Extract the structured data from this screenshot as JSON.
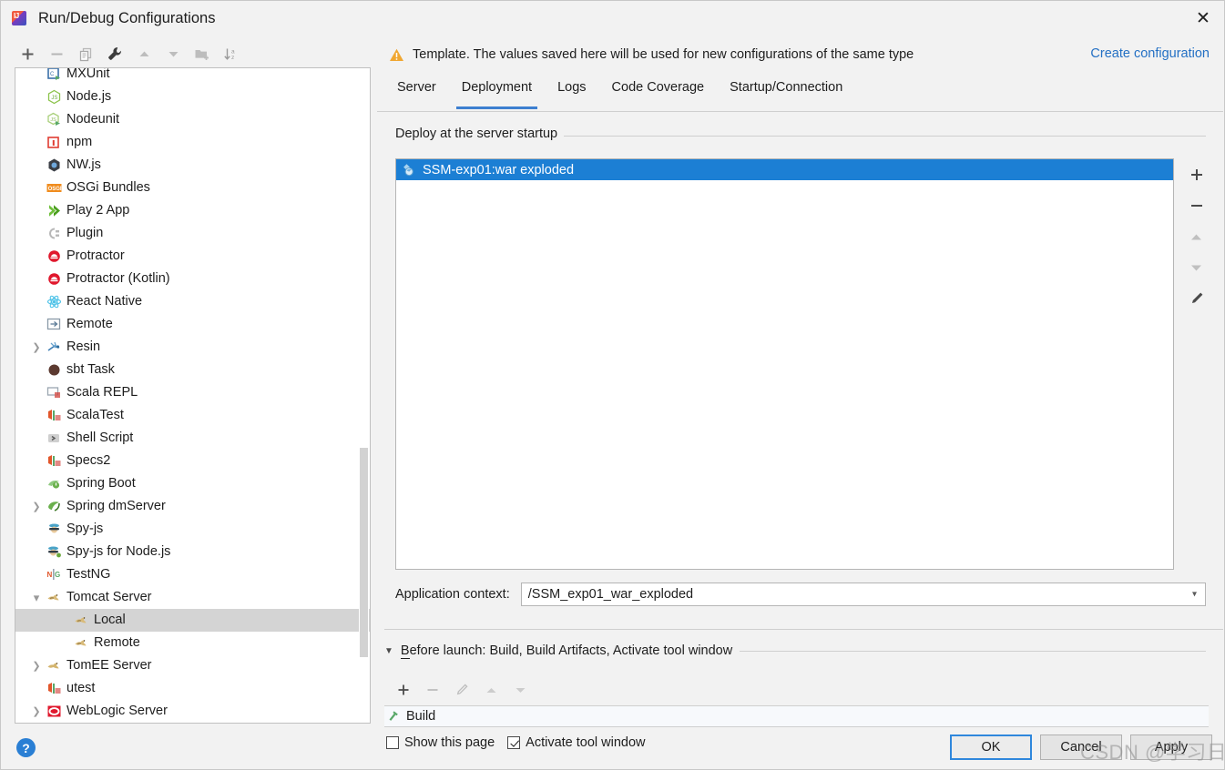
{
  "window": {
    "title": "Run/Debug Configurations",
    "app_icon": "intellij-idea-icon",
    "close_label": "✕"
  },
  "left_toolbar": {
    "buttons": [
      {
        "name": "add-configuration-button",
        "icon": "plus-icon",
        "label": "+"
      },
      {
        "name": "remove-configuration-button",
        "icon": "minus-icon",
        "label": "−"
      },
      {
        "name": "copy-configuration-button",
        "icon": "copy-icon",
        "label": "Copy"
      },
      {
        "name": "edit-templates-button",
        "icon": "wrench-icon",
        "label": "Edit Templates"
      },
      {
        "name": "move-up-button",
        "icon": "arrow-up-icon",
        "label": "Move Up"
      },
      {
        "name": "move-down-button",
        "icon": "arrow-down-icon",
        "label": "Move Down"
      },
      {
        "name": "new-folder-button",
        "icon": "folder-add-icon",
        "label": "New Folder"
      },
      {
        "name": "sort-configurations-button",
        "icon": "sort-az-icon",
        "label": "Sort"
      }
    ]
  },
  "tree": {
    "items": [
      {
        "label": "MXUnit",
        "icon": "mxunit-icon",
        "indent": 0,
        "arrow": "none",
        "selected": false
      },
      {
        "label": "Node.js",
        "icon": "nodejs-icon",
        "indent": 0,
        "arrow": "none",
        "selected": false
      },
      {
        "label": "Nodeunit",
        "icon": "nodeunit-icon",
        "indent": 0,
        "arrow": "none",
        "selected": false
      },
      {
        "label": "npm",
        "icon": "npm-icon",
        "indent": 0,
        "arrow": "none",
        "selected": false
      },
      {
        "label": "NW.js",
        "icon": "nwjs-icon",
        "indent": 0,
        "arrow": "none",
        "selected": false
      },
      {
        "label": "OSGi Bundles",
        "icon": "osgi-icon",
        "indent": 0,
        "arrow": "none",
        "selected": false
      },
      {
        "label": "Play 2 App",
        "icon": "play2-icon",
        "indent": 0,
        "arrow": "none",
        "selected": false
      },
      {
        "label": "Plugin",
        "icon": "plugin-icon",
        "indent": 0,
        "arrow": "none",
        "selected": false
      },
      {
        "label": "Protractor",
        "icon": "protractor-icon",
        "indent": 0,
        "arrow": "none",
        "selected": false
      },
      {
        "label": "Protractor (Kotlin)",
        "icon": "protractor-kotlin-icon",
        "indent": 0,
        "arrow": "none",
        "selected": false
      },
      {
        "label": "React Native",
        "icon": "react-native-icon",
        "indent": 0,
        "arrow": "none",
        "selected": false
      },
      {
        "label": "Remote",
        "icon": "remote-icon",
        "indent": 0,
        "arrow": "none",
        "selected": false
      },
      {
        "label": "Resin",
        "icon": "resin-icon",
        "indent": 0,
        "arrow": "collapsed",
        "selected": false
      },
      {
        "label": "sbt Task",
        "icon": "sbt-icon",
        "indent": 0,
        "arrow": "none",
        "selected": false
      },
      {
        "label": "Scala REPL",
        "icon": "scala-repl-icon",
        "indent": 0,
        "arrow": "none",
        "selected": false
      },
      {
        "label": "ScalaTest",
        "icon": "scalatest-icon",
        "indent": 0,
        "arrow": "none",
        "selected": false
      },
      {
        "label": "Shell Script",
        "icon": "shell-script-icon",
        "indent": 0,
        "arrow": "none",
        "selected": false
      },
      {
        "label": "Specs2",
        "icon": "specs2-icon",
        "indent": 0,
        "arrow": "none",
        "selected": false
      },
      {
        "label": "Spring Boot",
        "icon": "spring-boot-icon",
        "indent": 0,
        "arrow": "none",
        "selected": false
      },
      {
        "label": "Spring dmServer",
        "icon": "spring-dmserver-icon",
        "indent": 0,
        "arrow": "collapsed",
        "selected": false
      },
      {
        "label": "Spy-js",
        "icon": "spyjs-icon",
        "indent": 0,
        "arrow": "none",
        "selected": false
      },
      {
        "label": "Spy-js for Node.js",
        "icon": "spyjs-node-icon",
        "indent": 0,
        "arrow": "none",
        "selected": false
      },
      {
        "label": "TestNG",
        "icon": "testng-icon",
        "indent": 0,
        "arrow": "none",
        "selected": false
      },
      {
        "label": "Tomcat Server",
        "icon": "tomcat-icon",
        "indent": 0,
        "arrow": "expanded",
        "selected": false
      },
      {
        "label": "Local",
        "icon": "tomcat-icon",
        "indent": 1,
        "arrow": "none",
        "selected": true
      },
      {
        "label": "Remote",
        "icon": "tomcat-icon",
        "indent": 1,
        "arrow": "none",
        "selected": false
      },
      {
        "label": "TomEE Server",
        "icon": "tomee-icon",
        "indent": 0,
        "arrow": "collapsed",
        "selected": false
      },
      {
        "label": "utest",
        "icon": "utest-icon",
        "indent": 0,
        "arrow": "none",
        "selected": false
      },
      {
        "label": "WebLogic Server",
        "icon": "weblogic-icon",
        "indent": 0,
        "arrow": "collapsed",
        "selected": false
      }
    ]
  },
  "help": {
    "label": "?",
    "icon": "help-icon"
  },
  "banner": {
    "icon": "warning-icon",
    "text": "Template. The values saved here will be used for new configurations of the same type",
    "link": "Create configuration"
  },
  "tabs": [
    {
      "label": "Server",
      "active": false
    },
    {
      "label": "Deployment",
      "active": true
    },
    {
      "label": "Logs",
      "active": false
    },
    {
      "label": "Code Coverage",
      "active": false
    },
    {
      "label": "Startup/Connection",
      "active": false
    }
  ],
  "deployment": {
    "group_title": "Deploy at the server startup",
    "items": [
      {
        "label": "SSM-exp01:war exploded",
        "icon": "artifact-icon",
        "selected": true
      }
    ],
    "side_buttons": [
      {
        "name": "add-artifact-button",
        "icon": "plus-icon",
        "label": "+"
      },
      {
        "name": "remove-artifact-button",
        "icon": "minus-icon",
        "label": "−"
      },
      {
        "name": "move-artifact-up-button",
        "icon": "arrow-up-icon",
        "label": "Move Up"
      },
      {
        "name": "move-artifact-down-button",
        "icon": "arrow-down-icon",
        "label": "Move Down"
      },
      {
        "name": "edit-artifact-button",
        "icon": "pencil-icon",
        "label": "Edit"
      }
    ],
    "context_label": "Application context:",
    "context_value": "/SSM_exp01_war_exploded",
    "context_placeholder": ""
  },
  "before_launch": {
    "title_prefix": "B",
    "title": "Before launch: Build, Build Artifacts, Activate tool window",
    "toolbar": [
      {
        "name": "add-task-button",
        "icon": "plus-icon",
        "label": "+"
      },
      {
        "name": "remove-task-button",
        "icon": "minus-icon",
        "label": "−"
      },
      {
        "name": "edit-task-button",
        "icon": "pencil-icon",
        "label": "Edit"
      },
      {
        "name": "task-move-up-button",
        "icon": "arrow-up-icon",
        "label": "Move Up"
      },
      {
        "name": "task-move-down-button",
        "icon": "arrow-down-icon",
        "label": "Move Down"
      }
    ],
    "tasks": [
      {
        "label": "Build",
        "icon": "build-hammer-icon"
      }
    ],
    "checkboxes": [
      {
        "label": "Show this page",
        "checked": false,
        "name": "show-this-page-checkbox"
      },
      {
        "label": "Activate tool window",
        "checked": true,
        "name": "activate-tool-window-checkbox"
      }
    ]
  },
  "dialog_buttons": [
    {
      "label": "OK",
      "primary": true,
      "name": "ok-button"
    },
    {
      "label": "Cancel",
      "primary": false,
      "name": "cancel-button"
    },
    {
      "label": "Apply",
      "primary": false,
      "name": "apply-button"
    }
  ],
  "watermark": "CSDN @学习日记",
  "colors": {
    "accent": "#2470c4",
    "selection": "#1c7fd4",
    "tab_underline": "#3d7fd0",
    "warning": "#f0a732",
    "window_bg": "#f2f2f2"
  }
}
